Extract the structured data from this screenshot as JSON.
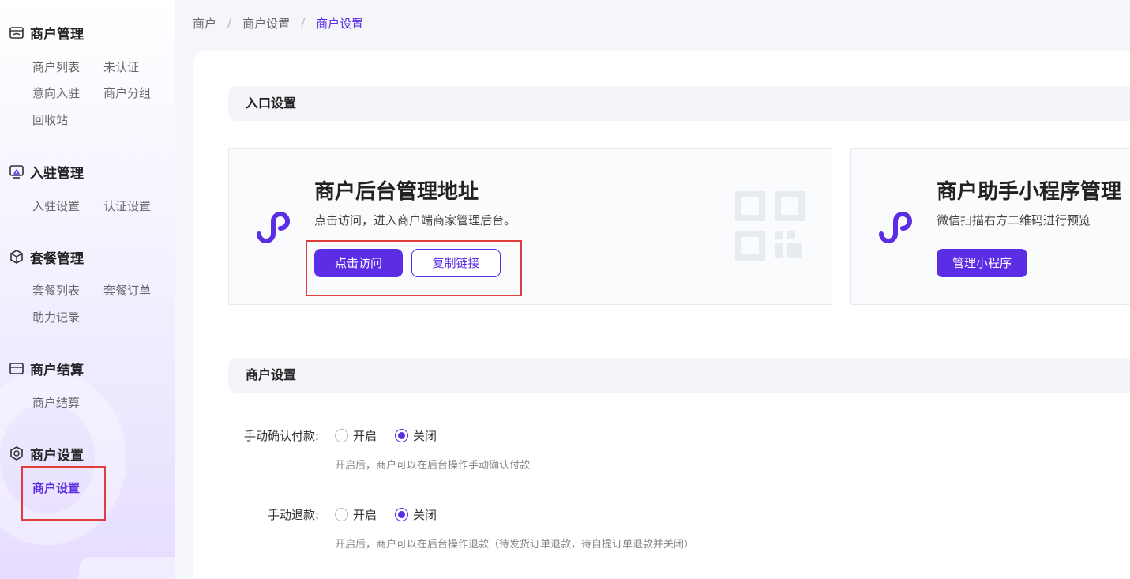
{
  "sidebar": {
    "groups": [
      {
        "title": "商户管理",
        "icon": "shop-icon",
        "items": [
          "商户列表",
          "未认证",
          "意向入驻",
          "商户分组",
          "回收站"
        ]
      },
      {
        "title": "入驻管理",
        "icon": "monitor-icon",
        "items": [
          "入驻设置",
          "认证设置"
        ]
      },
      {
        "title": "套餐管理",
        "icon": "package-icon",
        "items": [
          "套餐列表",
          "套餐订单",
          "助力记录"
        ]
      },
      {
        "title": "商户结算",
        "icon": "wallet-icon",
        "items": [
          "商户结算"
        ]
      },
      {
        "title": "商户设置",
        "icon": "settings-hex-icon",
        "items": [
          "商户设置"
        ]
      }
    ]
  },
  "breadcrumb": [
    "商户",
    "商户设置",
    "商户设置"
  ],
  "main": {
    "entry_section_title": "入口设置",
    "cards": [
      {
        "title": "商户后台管理地址",
        "desc": "点击访问，进入商户端商家管理后台。",
        "primary_label": "点击访问",
        "secondary_label": "复制链接"
      },
      {
        "title": "商户助手小程序管理",
        "desc": "微信扫描右方二维码进行预览",
        "primary_label": "管理小程序"
      }
    ],
    "settings_section_title": "商户设置",
    "settings": [
      {
        "label": "手动确认付款:",
        "options": [
          "开启",
          "关闭"
        ],
        "selected": "关闭",
        "hint": "开启后，商户可以在后台操作手动确认付款"
      },
      {
        "label": "手动退款:",
        "options": [
          "开启",
          "关闭"
        ],
        "selected": "关闭",
        "hint": "开启后，商户可以在后台操作退款（待发货订单退款，待自提订单退款并关闭）"
      }
    ]
  },
  "colors": {
    "accent": "#5b2ee6",
    "highlight_border": "#e03c3c"
  }
}
